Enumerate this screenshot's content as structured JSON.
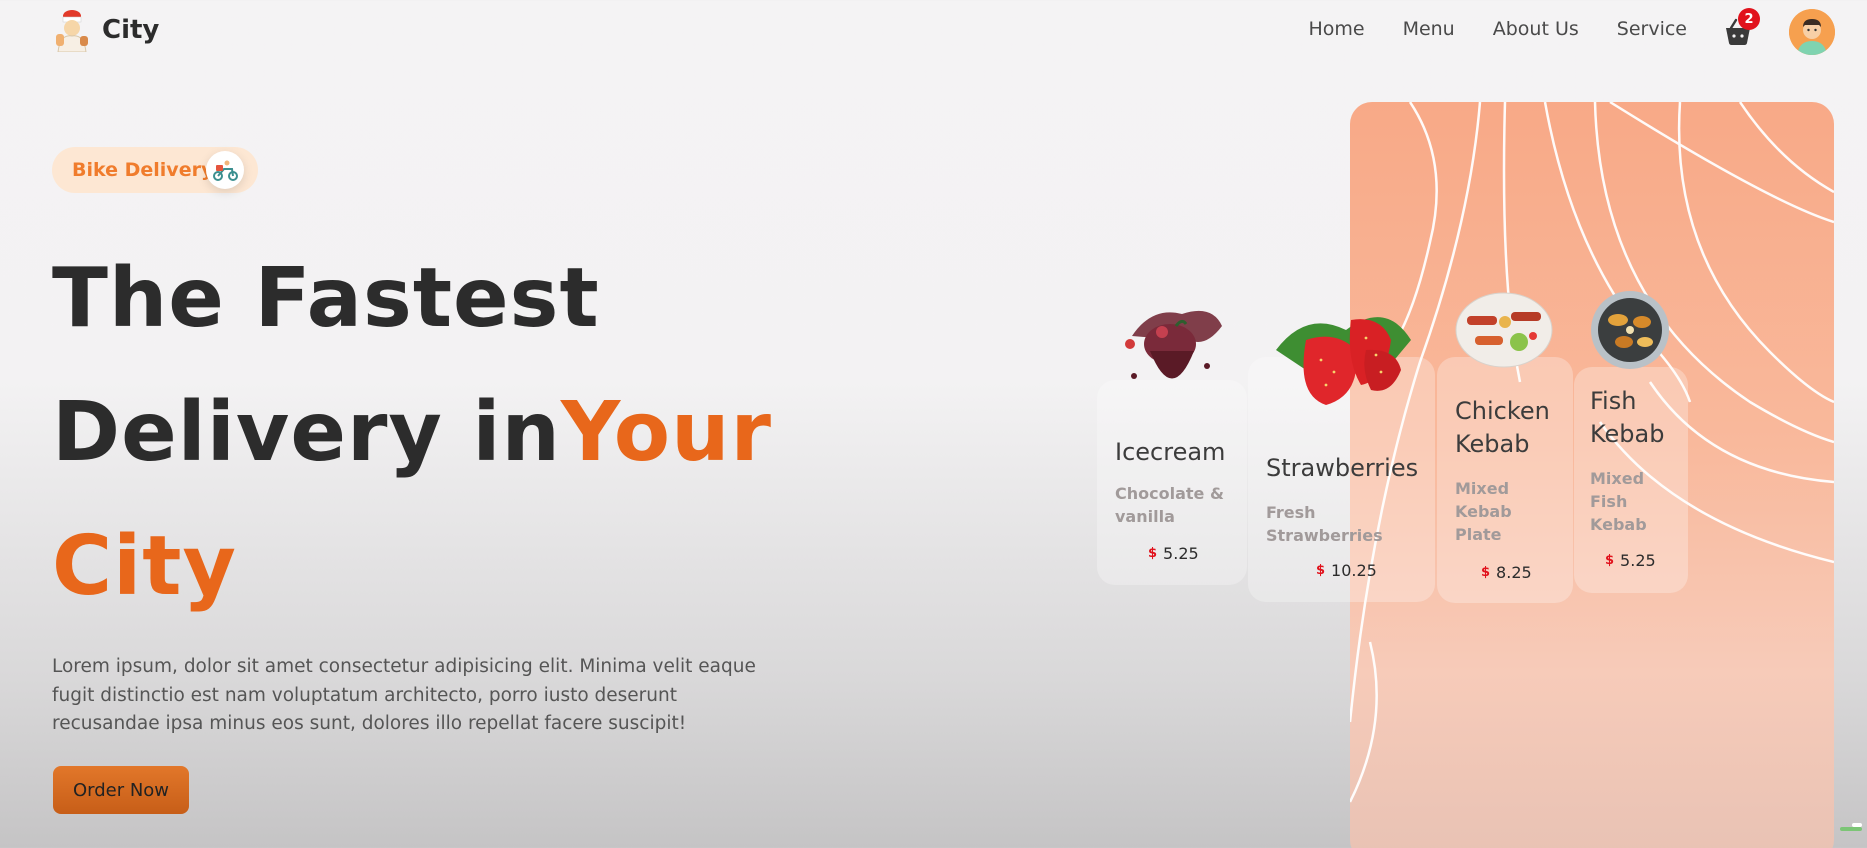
{
  "brand": {
    "name": "City"
  },
  "nav": {
    "items": [
      {
        "label": "Home"
      },
      {
        "label": "Menu"
      },
      {
        "label": "About Us"
      },
      {
        "label": "Service"
      }
    ]
  },
  "cart": {
    "count": "2",
    "icon": "basket-icon"
  },
  "user": {
    "icon": "user-avatar"
  },
  "hero": {
    "badge_label": "Bike Delivery",
    "badge_icon": "scooter-icon",
    "title_line1": "The Fastest",
    "title_line2_a": "Delivery in",
    "title_line2_b": "Your",
    "title_line3": "City",
    "description": "Lorem ipsum, dolor sit amet consectetur adipisicing elit. Minima velit eaque fugit distinctio est nam voluptatum architecto, porro iusto deserunt recusandae ipsa minus eos sunt, dolores illo repellat facere suscipit!",
    "order_button": "Order Now"
  },
  "menu_cards": [
    {
      "name": "Icecream",
      "desc": "Chocolate & vanilla",
      "currency": "$",
      "price": "5.25",
      "image": "icecream"
    },
    {
      "name": "Strawberries",
      "desc": "Fresh Strawberries",
      "currency": "$",
      "price": "10.25",
      "image": "strawberries"
    },
    {
      "name": "Chicken Kebab",
      "desc": "Mixed Kebab Plate",
      "currency": "$",
      "price": "8.25",
      "image": "chicken-kebab"
    },
    {
      "name": "Fish Kebab",
      "desc": "Mixed Fish Kebab",
      "currency": "$",
      "price": "5.25",
      "image": "fish-kebab"
    }
  ],
  "colors": {
    "accent": "#e8671b",
    "badge_bg": "#fde7d3",
    "panel": "#f8a987",
    "price_currency": "#e1121c"
  }
}
